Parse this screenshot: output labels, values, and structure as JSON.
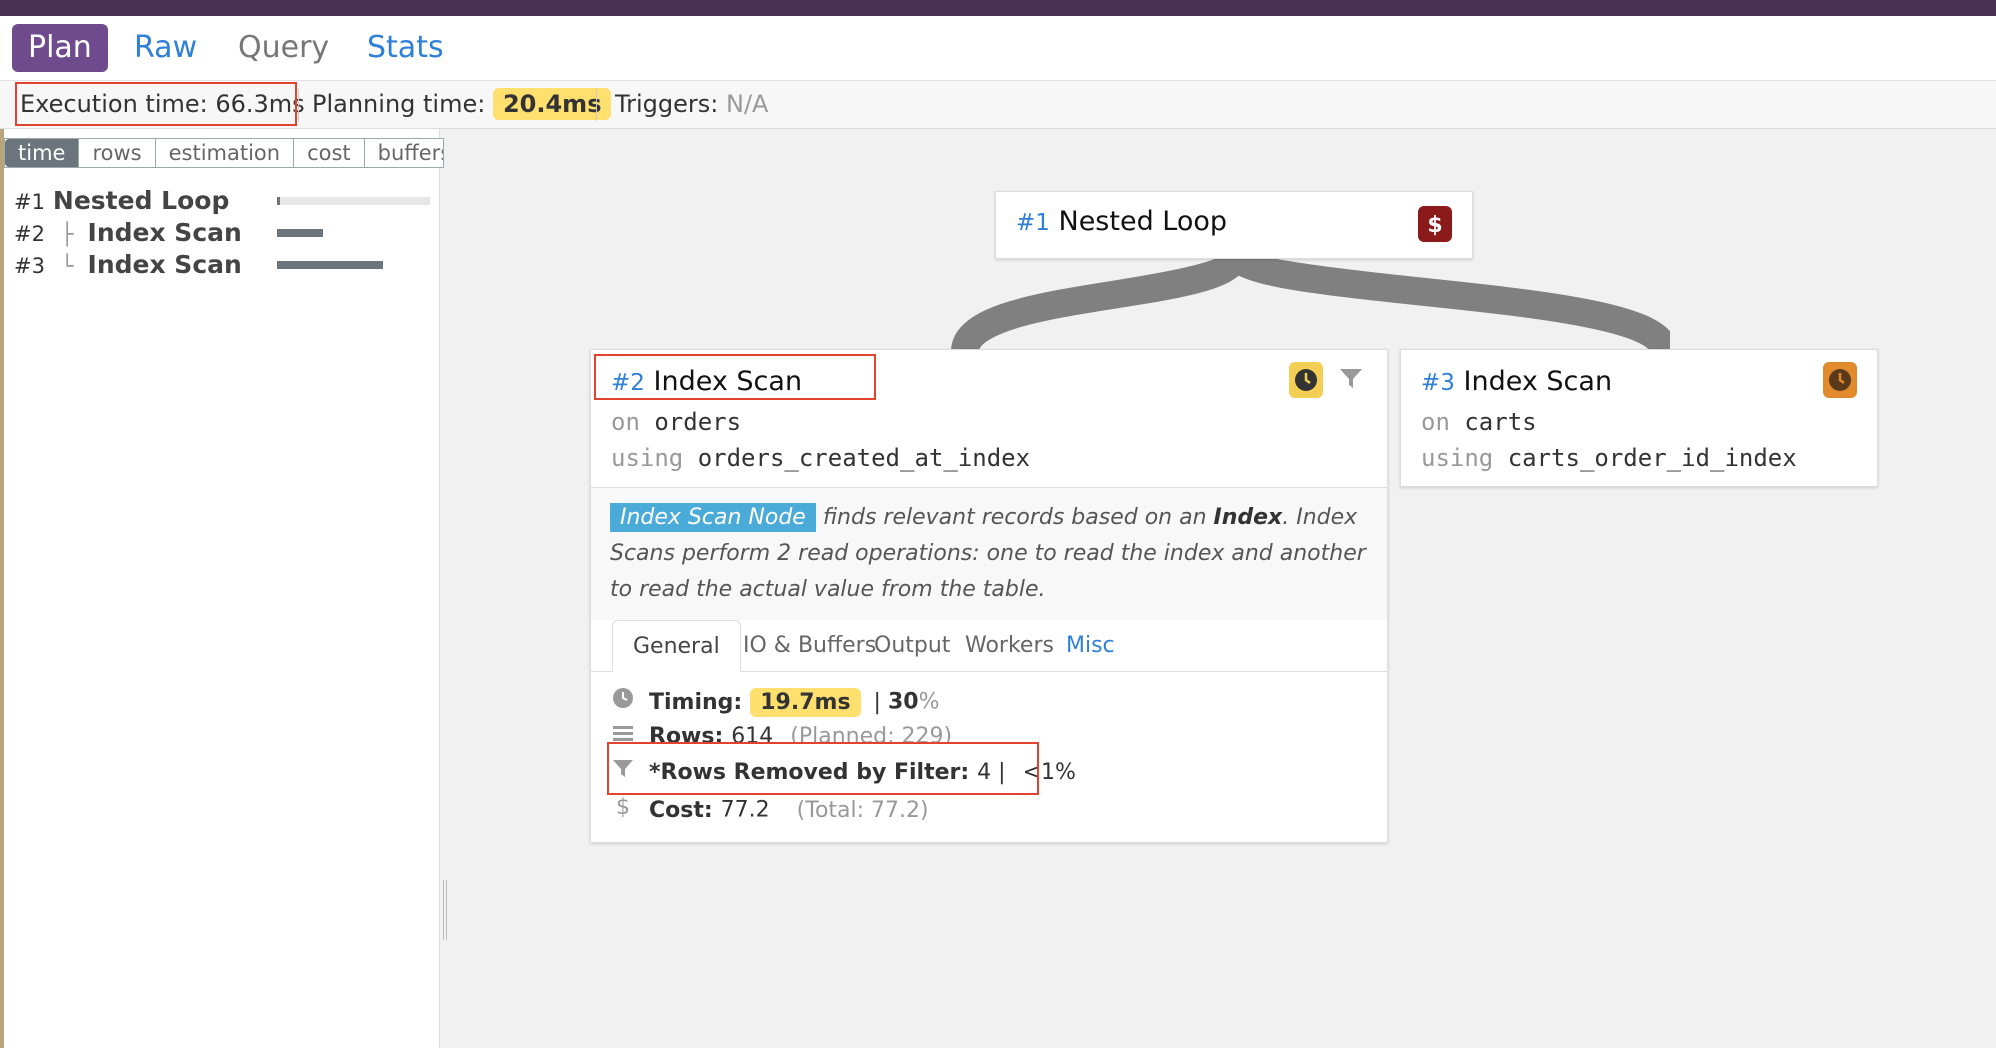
{
  "tabs": [
    {
      "label": "Plan"
    },
    {
      "label": "Raw"
    },
    {
      "label": "Query"
    },
    {
      "label": "Stats"
    }
  ],
  "info": {
    "execution": "Execution time: 66.3ms",
    "planning_label": "Planning time:",
    "planning_value": "20.4ms",
    "triggers_label": "Triggers:",
    "triggers_value": "N/A"
  },
  "metric_tabs": [
    "time",
    "rows",
    "estimation",
    "cost",
    "buffers"
  ],
  "tree": [
    {
      "num": "#1",
      "connector": "",
      "name": "Nested Loop",
      "bar_fraction": 0.02
    },
    {
      "num": "#2",
      "connector": "├",
      "name": "Index Scan",
      "bar_fraction": 0.3
    },
    {
      "num": "#3",
      "connector": "└",
      "name": "Index Scan",
      "bar_fraction": 0.69
    }
  ],
  "nodes": {
    "n1": {
      "num": "#1",
      "name": "Nested Loop"
    },
    "n2": {
      "num": "#2",
      "name": "Index Scan",
      "on_kw": "on",
      "relation": "orders",
      "using_kw": "using",
      "index": "orders_created_at_index"
    },
    "n3": {
      "num": "#3",
      "name": "Index Scan",
      "on_kw": "on",
      "relation": "carts",
      "using_kw": "using",
      "index": "carts_order_id_index"
    }
  },
  "description": {
    "tag": "Index Scan Node",
    "part1": " finds relevant records based on an ",
    "bold": "Index",
    "part2": ". Index Scans perform 2 read operations: one to read the index and another to read the actual value from the table."
  },
  "detail_tabs": [
    "General",
    "IO & Buffers",
    "Output",
    "Workers",
    "Misc"
  ],
  "stats": {
    "timing_label": "Timing:",
    "timing_value": "19.7ms",
    "timing_sep": "|",
    "timing_pct": "30",
    "timing_pct_sign": "%",
    "rows_label": "Rows:",
    "rows_value": "614",
    "rows_planned": "(Planned: 229)",
    "filter_label": "*Rows Removed by Filter:",
    "filter_value": "4 |",
    "filter_pct": "<1%",
    "cost_label": "Cost:",
    "cost_value": "77.2",
    "cost_total": "(Total: 77.2)"
  },
  "colors": {
    "brand": "#6f4a8c",
    "link": "#2f80d6",
    "highlight": "#ffe06f",
    "cost_badge": "#8b1a1a",
    "clock_badge_yellow": "#f3cf55",
    "clock_badge_orange": "#e08a2c",
    "node_tag": "#4aaad8",
    "annotation": "#e0432f"
  },
  "icons": {
    "cost": "dollar-icon",
    "time": "clock-icon",
    "filter": "filter-icon",
    "rows": "rows-icon"
  }
}
